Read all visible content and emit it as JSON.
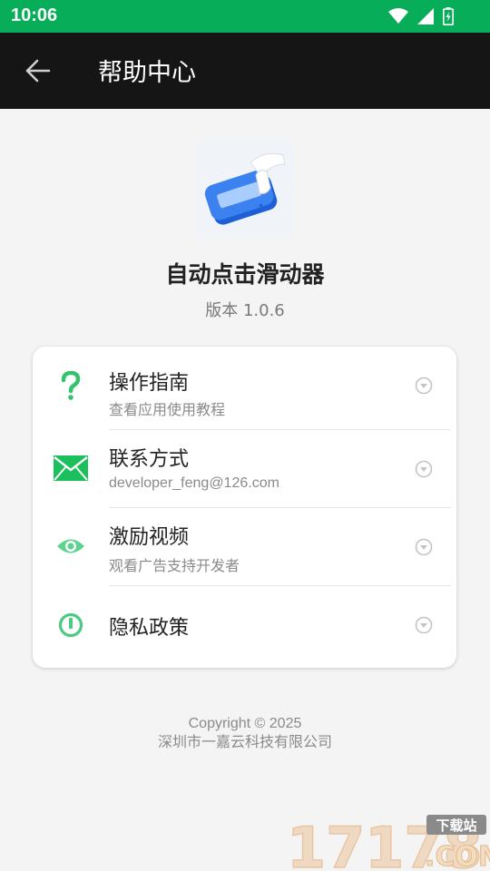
{
  "status_bar": {
    "time": "10:06"
  },
  "appbar": {
    "title": "帮助中心"
  },
  "app": {
    "name": "自动点击滑动器",
    "version": "版本 1.0.6"
  },
  "menu": [
    {
      "title": "操作指南",
      "subtitle": "查看应用使用教程",
      "icon": "question-icon",
      "color": "#34c26f"
    },
    {
      "title": "联系方式",
      "subtitle": "developer_feng@126.com",
      "icon": "mail-icon",
      "color": "#1bbf5b"
    },
    {
      "title": "激励视频",
      "subtitle": "观看广告支持开发者",
      "icon": "eye-icon",
      "color": "#5ed28f"
    },
    {
      "title": "隐私政策",
      "subtitle": "",
      "icon": "power-icon",
      "color": "#4cc983"
    }
  ],
  "footer": {
    "copyright": "Copyright © 2025",
    "company": "深圳市一嘉云科技有限公司"
  },
  "watermark": {
    "number": "17178",
    "domain": ".COM",
    "badge": "下载站"
  },
  "colors": {
    "status_bar": "#08ad5a",
    "appbar": "#151515",
    "background": "#f4f4f4"
  }
}
